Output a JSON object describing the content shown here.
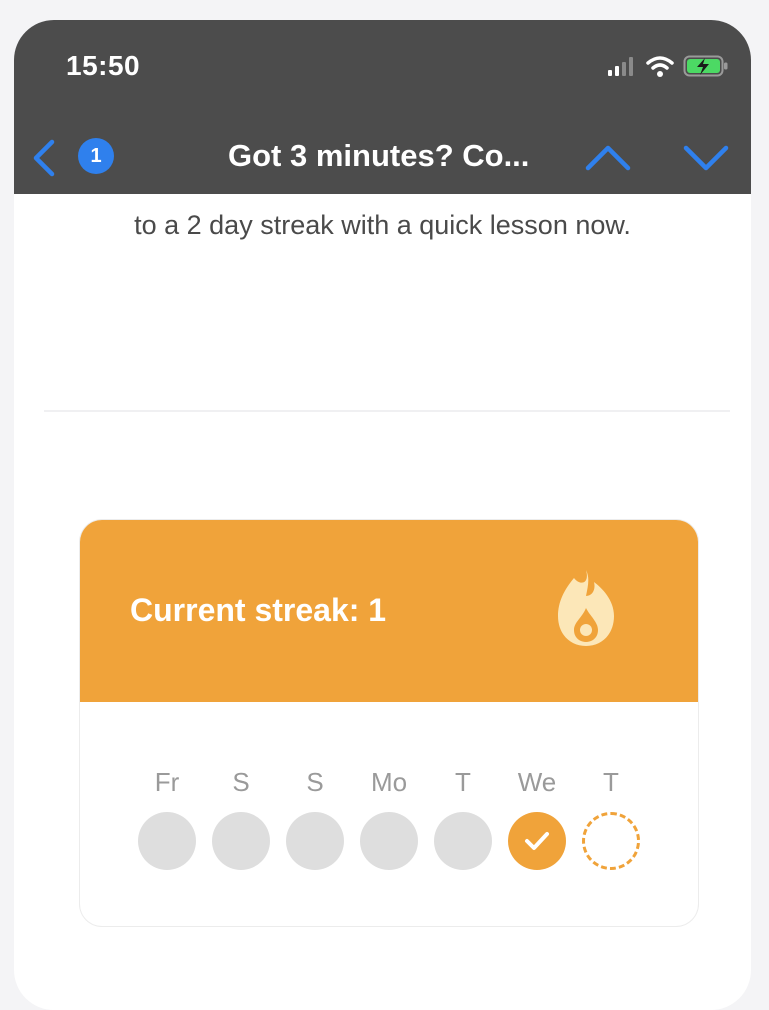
{
  "status_bar": {
    "time": "15:50",
    "signal_icon": "signal-bars-icon",
    "wifi_icon": "wifi-icon",
    "battery_icon": "battery-charging-icon"
  },
  "nav": {
    "back_icon": "chevron-left-icon",
    "unread_count": "1",
    "title": "Got 3 minutes? Co...",
    "prev_icon": "chevron-up-icon",
    "next_icon": "chevron-down-icon"
  },
  "email": {
    "body_line": "to a 2 day streak with a quick lesson now."
  },
  "streak_card": {
    "title": "Current streak: 1",
    "icon": "flame-icon",
    "days": [
      {
        "label": "Fr",
        "state": "missed"
      },
      {
        "label": "S",
        "state": "missed"
      },
      {
        "label": "S",
        "state": "missed"
      },
      {
        "label": "Mo",
        "state": "missed"
      },
      {
        "label": "T",
        "state": "missed"
      },
      {
        "label": "We",
        "state": "done"
      },
      {
        "label": "T",
        "state": "today"
      }
    ]
  },
  "colors": {
    "topbar": "#4c4c4c",
    "accent_orange": "#f0a33a",
    "badge_blue": "#2f80ed",
    "dot_inactive": "#dedede",
    "text_gray": "#4a4a4a",
    "day_label_gray": "#9a9a9a"
  }
}
